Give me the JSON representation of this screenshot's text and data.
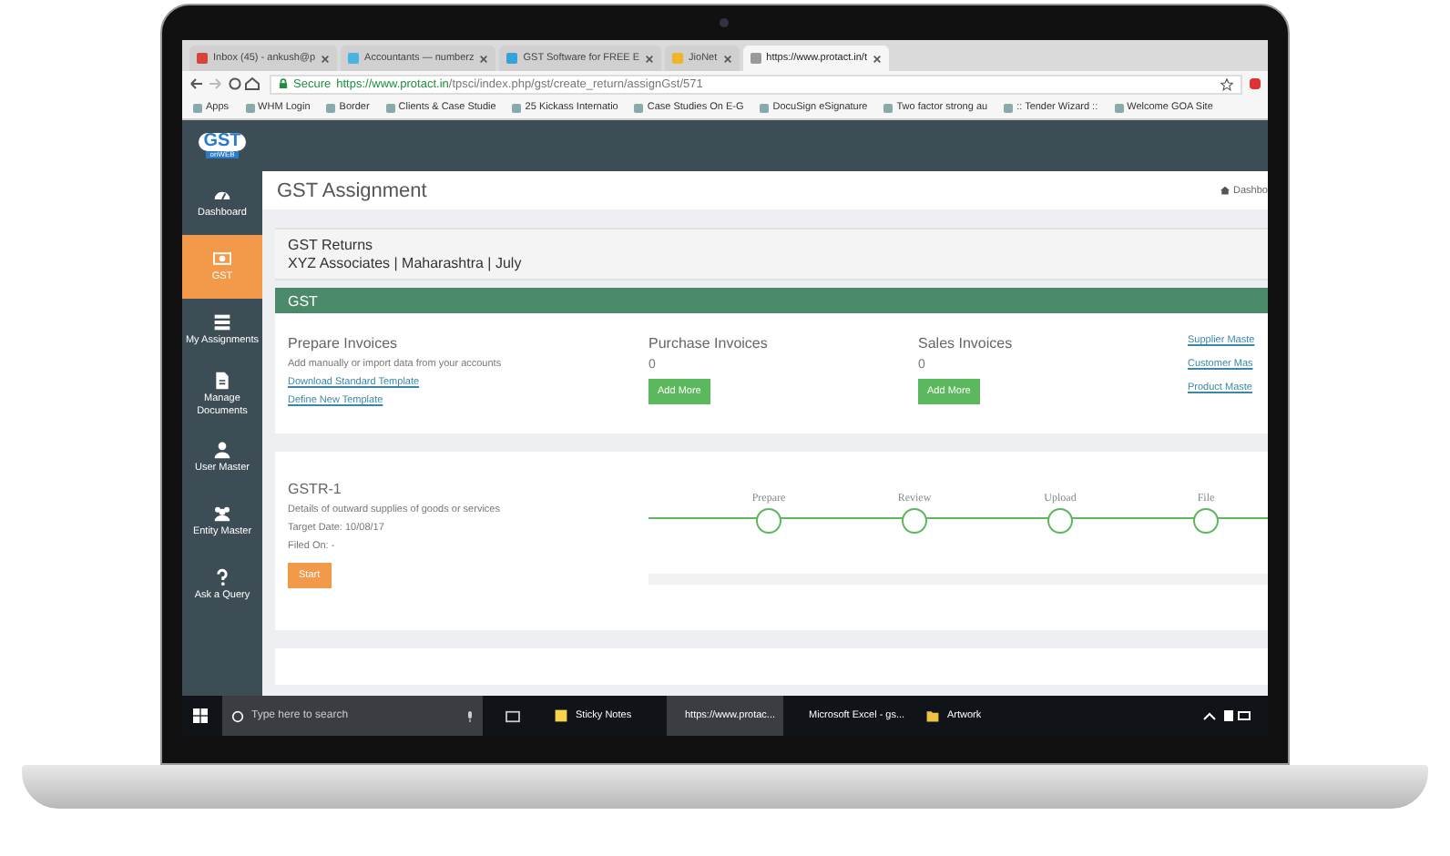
{
  "browser": {
    "tabs": [
      {
        "label": "Inbox (45) - ankush@p",
        "selected": false
      },
      {
        "label": "Accountants — numberz",
        "selected": false
      },
      {
        "label": "GST Software for FREE E",
        "selected": false
      },
      {
        "label": "JioNet",
        "selected": false
      },
      {
        "label": "https://www.protact.in/t",
        "selected": true
      }
    ],
    "secure_label": "Secure",
    "url_host": "https://www.protact.in",
    "url_path": "/tpsci/index.php/gst/create_return/assignGst/571",
    "bookmarks": [
      "Apps",
      "WHM Login",
      "Border",
      "Clients & Case Studie",
      "25 Kickass Internatio",
      "Case Studies On E-G",
      "DocuSign eSignature",
      "Two factor strong au",
      ":: Tender Wizard ::",
      "Welcome GOA Site"
    ]
  },
  "logo": {
    "title": "GST",
    "subtitle": "onWEB"
  },
  "sidebar": {
    "items": [
      {
        "label": "Dashboard",
        "kind": "dashboard",
        "selected": false
      },
      {
        "label": "GST",
        "kind": "money",
        "selected": true
      },
      {
        "label": "My Assignments",
        "kind": "list",
        "selected": false
      },
      {
        "label": "Manage Documents",
        "kind": "document",
        "selected": false
      },
      {
        "label": "User Master",
        "kind": "user",
        "selected": false
      },
      {
        "label": "Entity Master",
        "kind": "users",
        "selected": false
      },
      {
        "label": "Ask a Query",
        "kind": "question",
        "selected": false
      }
    ]
  },
  "page": {
    "title": "GST Assignment",
    "breadcrumb": "Dashbo"
  },
  "returns": {
    "title": "GST Returns",
    "subtitle": "XYZ Associates | Maharashtra | July"
  },
  "section": {
    "title": "GST"
  },
  "prepare": {
    "title": "Prepare Invoices",
    "description": "Add manually or import data from your accounts",
    "links": [
      "Download Standard Template",
      "Define New Template"
    ]
  },
  "invoices": [
    {
      "title": "Purchase Invoices",
      "count": "0",
      "button": "Add More"
    },
    {
      "title": "Sales Invoices",
      "count": "0",
      "button": "Add More"
    }
  ],
  "masters": [
    "Supplier Maste",
    "Customer Mas",
    "Product Maste"
  ],
  "gstr": {
    "title": "GSTR-1",
    "description": "Details of outward supplies of goods or services",
    "target": "Target Date: 10/08/17",
    "filed": "Filed On: -",
    "button": "Start"
  },
  "steps": [
    "Prepare",
    "Review",
    "Upload",
    "File"
  ],
  "taskbar": {
    "search_placeholder": "Type here to search",
    "apps": [
      {
        "label": "Sticky Notes",
        "kind": "notes",
        "selected": false
      },
      {
        "label": "https://www.protac...",
        "kind": "browser",
        "selected": true
      },
      {
        "label": "Microsoft Excel - gs...",
        "kind": "sheet",
        "selected": false
      },
      {
        "label": "Artwork",
        "kind": "folder",
        "selected": false
      }
    ]
  }
}
